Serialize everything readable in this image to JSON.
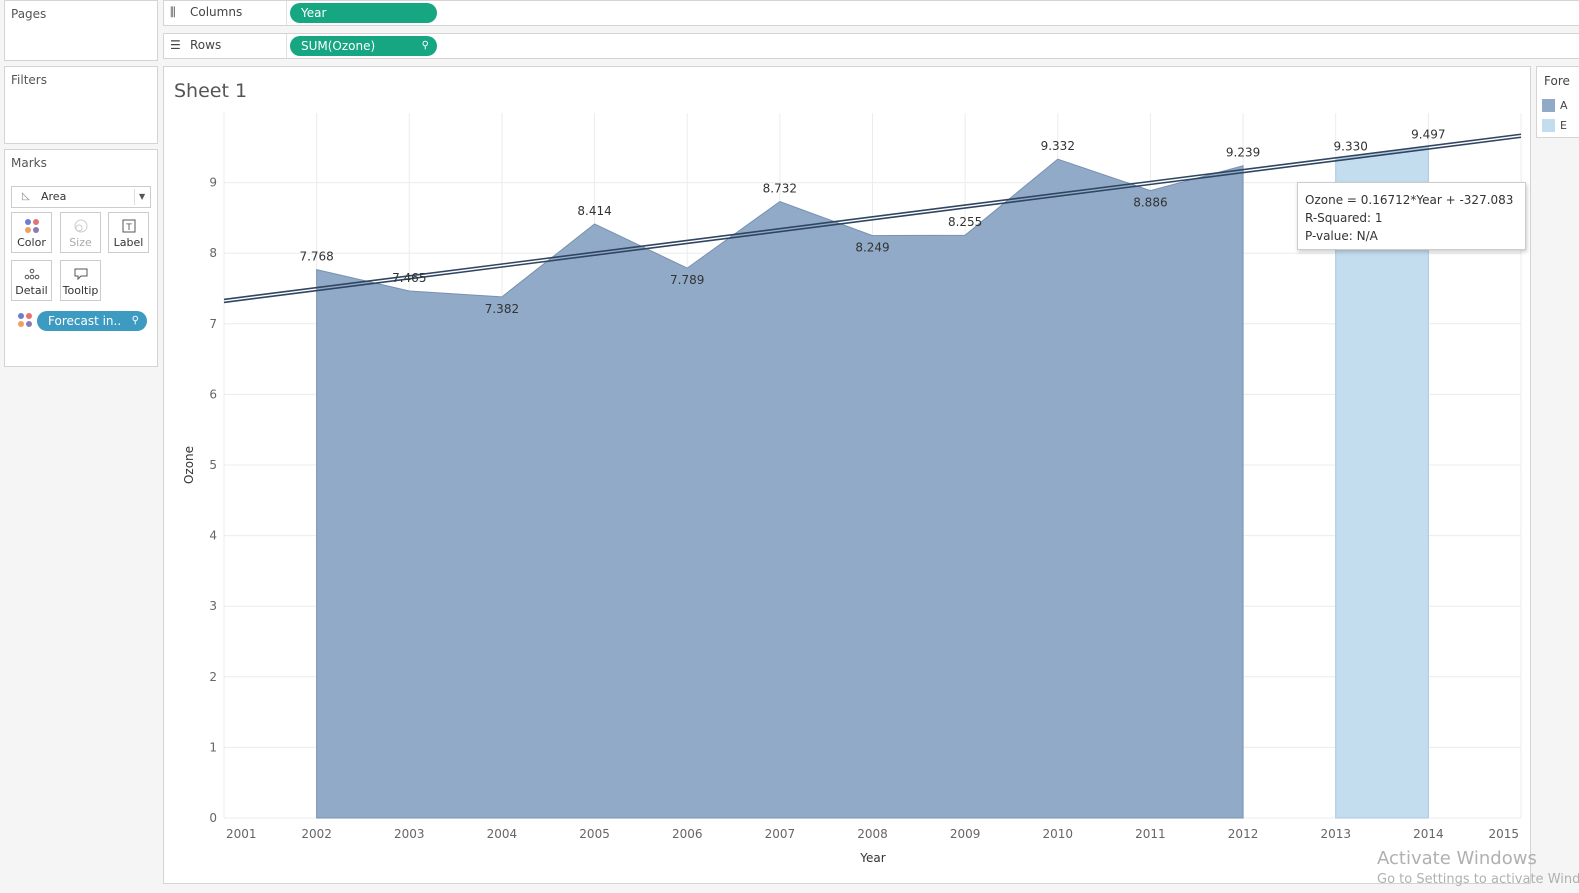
{
  "left_panel": {
    "pages_title": "Pages",
    "filters_title": "Filters",
    "marks": {
      "title": "Marks",
      "type_label": "Area",
      "buttons": {
        "color": "Color",
        "size": "Size",
        "label": "Label",
        "detail": "Detail",
        "tooltip": "Tooltip"
      },
      "color_pill": "Forecast in.."
    }
  },
  "shelves": {
    "columns_label": "Columns",
    "columns_pill": "Year",
    "rows_label": "Rows",
    "rows_pill": "SUM(Ozone)"
  },
  "sheet": {
    "title": "Sheet 1"
  },
  "legend": {
    "title": "Fore",
    "items": [
      {
        "label": "A",
        "color": "#91aac7"
      },
      {
        "label": "E",
        "color": "#c3dcee"
      }
    ]
  },
  "tooltip": {
    "line1": "Ozone = 0.16712*Year + -327.083",
    "line2": "R-Squared: 1",
    "line3": "P-value: N/A"
  },
  "chart_data": {
    "type": "area",
    "xlabel": "Year",
    "ylabel": "Ozone",
    "x_ticks": [
      2001,
      2002,
      2003,
      2004,
      2005,
      2006,
      2007,
      2008,
      2009,
      2010,
      2011,
      2012,
      2013,
      2014,
      2015
    ],
    "y_ticks": [
      0,
      1,
      2,
      3,
      4,
      5,
      6,
      7,
      8,
      9
    ],
    "xlim": [
      2001,
      2015
    ],
    "ylim": [
      0,
      10
    ],
    "grid": true,
    "series": [
      {
        "name": "A",
        "color": "#91aac7",
        "x": [
          2002,
          2003,
          2004,
          2005,
          2006,
          2007,
          2008,
          2009,
          2010,
          2011,
          2012
        ],
        "values": [
          7.768,
          7.465,
          7.382,
          8.414,
          7.789,
          8.732,
          8.249,
          8.255,
          9.332,
          8.886,
          9.239
        ],
        "labels": [
          "7.768",
          "7.465",
          "7.382",
          "8.414",
          "7.789",
          "8.732",
          "8.249",
          "8.255",
          "9.332",
          "8.886",
          "9.239"
        ]
      },
      {
        "name": "E",
        "color": "#c3dcee",
        "x": [
          2013,
          2014
        ],
        "values": [
          9.33,
          9.497
        ],
        "labels": [
          "9.330",
          "9.497"
        ]
      }
    ],
    "trend_line": {
      "slope": 0.16712,
      "intercept": -327.083,
      "color": "#2f4560"
    }
  },
  "watermark": {
    "line1": "Activate Windows",
    "line2": "Go to Settings to activate Windows."
  }
}
